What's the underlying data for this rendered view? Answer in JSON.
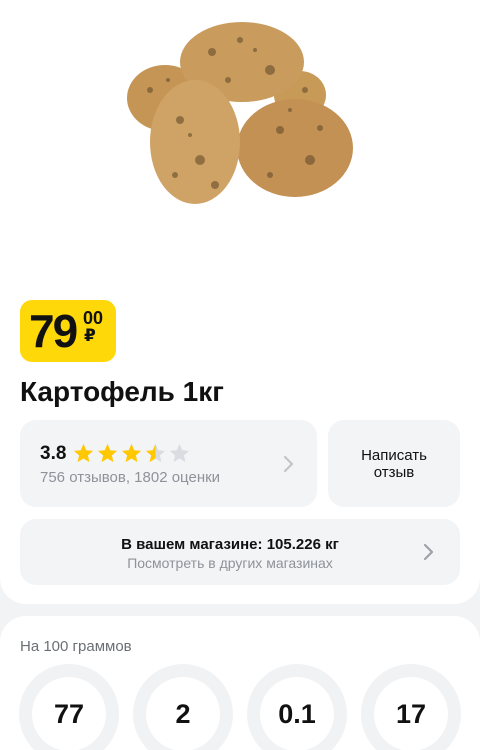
{
  "product": {
    "image_name": "potatoes",
    "price_int": "79",
    "price_frac": "00",
    "currency": "₽",
    "title": "Картофель 1кг"
  },
  "rating": {
    "value": "3.8",
    "stars": 3.5,
    "max_stars": 5,
    "reviews_text": "756 отзывов, 1802 оценки"
  },
  "review_button": {
    "label": "Написать отзыв"
  },
  "store": {
    "availability": "В вашем магазине: 105.226 кг",
    "other_stores_link": "Посмотреть в других магазинах"
  },
  "nutrition": {
    "caption": "На 100 граммов",
    "values": [
      "77",
      "2",
      "0.1",
      "17"
    ]
  },
  "colors": {
    "accent_yellow": "#ffd80a",
    "star_filled": "#ffc800",
    "star_empty": "#d9dce1",
    "card_bg": "#f3f4f6"
  }
}
